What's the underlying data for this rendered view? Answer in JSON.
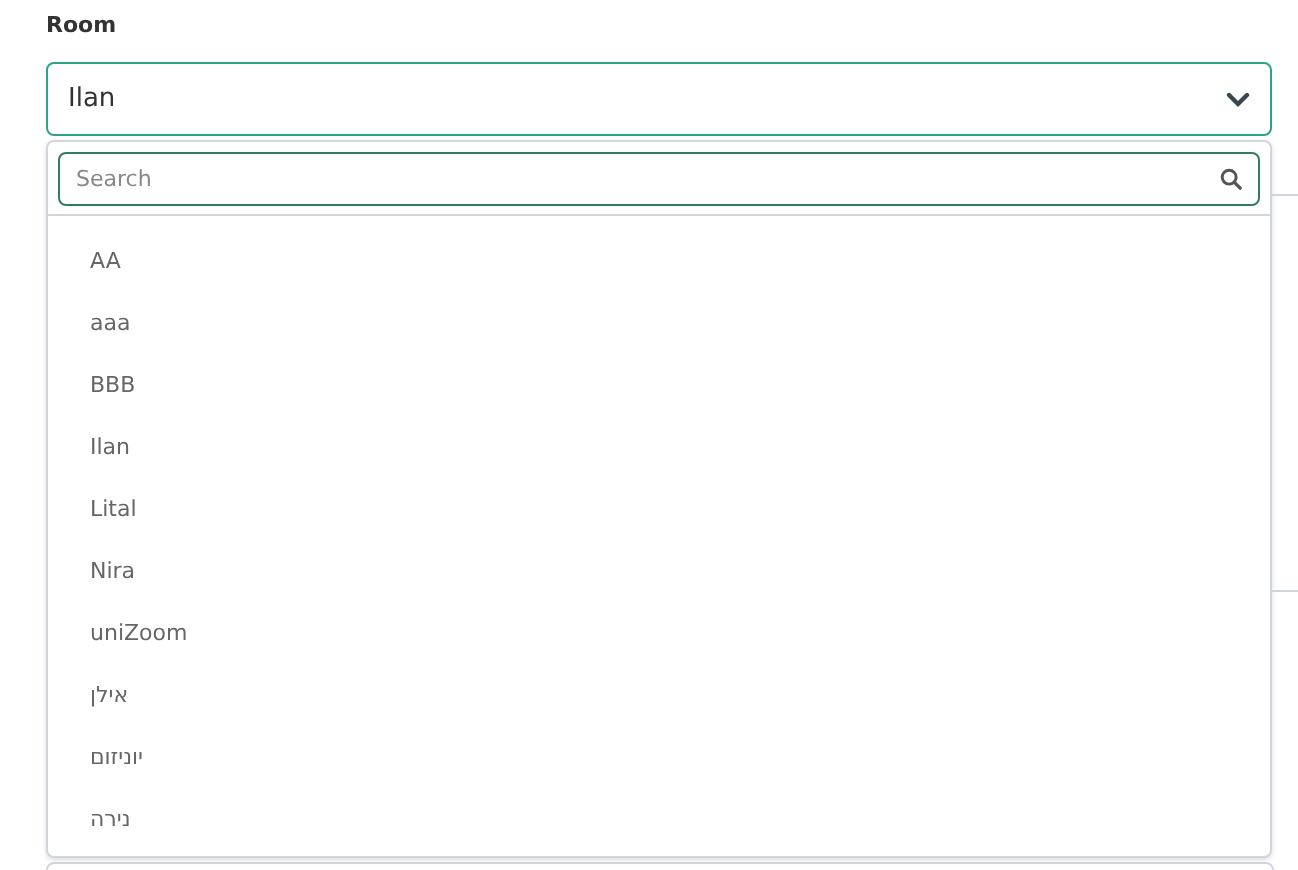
{
  "label": "Room",
  "select": {
    "value": "Ilan",
    "expanded": true
  },
  "search": {
    "placeholder": "Search"
  },
  "options": [
    "AA",
    "aaa",
    "BBB",
    "Ilan",
    "Lital",
    "Nira",
    "uniZoom",
    "אילן",
    "יוניזום",
    "נירה"
  ]
}
